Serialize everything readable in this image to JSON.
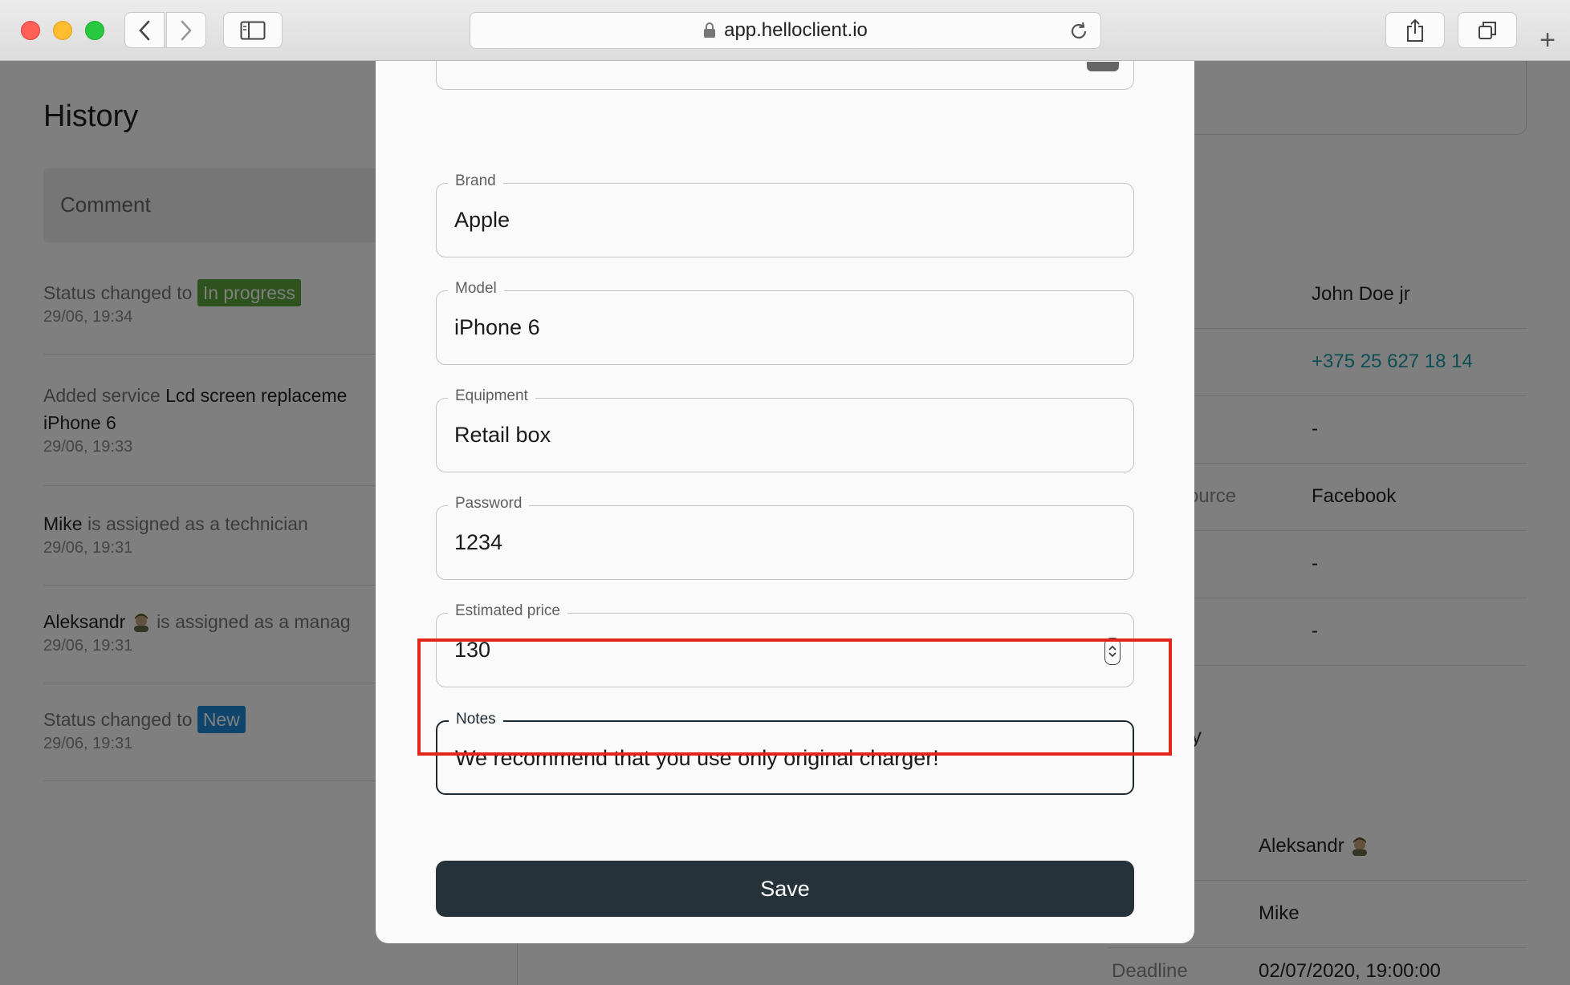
{
  "browser": {
    "url": "app.helloclient.io"
  },
  "history": {
    "title": "History",
    "comment_placeholder": "Comment",
    "items": [
      {
        "pre": "Status changed to",
        "badge": "In progress",
        "time": "29/06, 19:34"
      },
      {
        "pre": "Added service",
        "strong": "Lcd screen replaceme",
        "line2": "iPhone 6",
        "time": "29/06, 19:33"
      },
      {
        "strong": "Mike",
        "post": "is assigned as a technician",
        "time": "29/06, 19:31"
      },
      {
        "strong": "Aleksandr",
        "post": "is assigned as a manag",
        "time": "29/06, 19:31"
      },
      {
        "pre": "Status changed to",
        "badge": "New",
        "time": "29/06, 19:31"
      }
    ]
  },
  "client_info": {
    "rows": [
      {
        "label": "",
        "value": "John Doe jr"
      },
      {
        "label": "",
        "value": "+375 25 627 18 14"
      },
      {
        "label": "",
        "value": "-"
      },
      {
        "label": "ource",
        "value": "Facebook"
      },
      {
        "label": "",
        "value": "-"
      },
      {
        "label": "",
        "value": "-"
      }
    ],
    "section_partial": "y",
    "lower_rows": [
      {
        "label": "",
        "value": "Aleksandr"
      },
      {
        "label": "",
        "value": "Mike"
      },
      {
        "label": "Deadline",
        "value": "02/07/2020, 19:00:00"
      }
    ]
  },
  "modal": {
    "fields": [
      {
        "label": "Brand",
        "value": "Apple"
      },
      {
        "label": "Model",
        "value": "iPhone 6"
      },
      {
        "label": "Equipment",
        "value": "Retail box"
      },
      {
        "label": "Password",
        "value": "1234"
      },
      {
        "label": "Estimated price",
        "value": "130"
      },
      {
        "label": "Notes",
        "value": "We recommend that you use only original charger!"
      }
    ],
    "save_label": "Save"
  },
  "colors": {
    "highlight": "#e3261c",
    "save_button": "#26323a",
    "badge_in_progress": "#5aa43a",
    "badge_new": "#1e8ad8",
    "phone_link": "#1c9aa6"
  }
}
